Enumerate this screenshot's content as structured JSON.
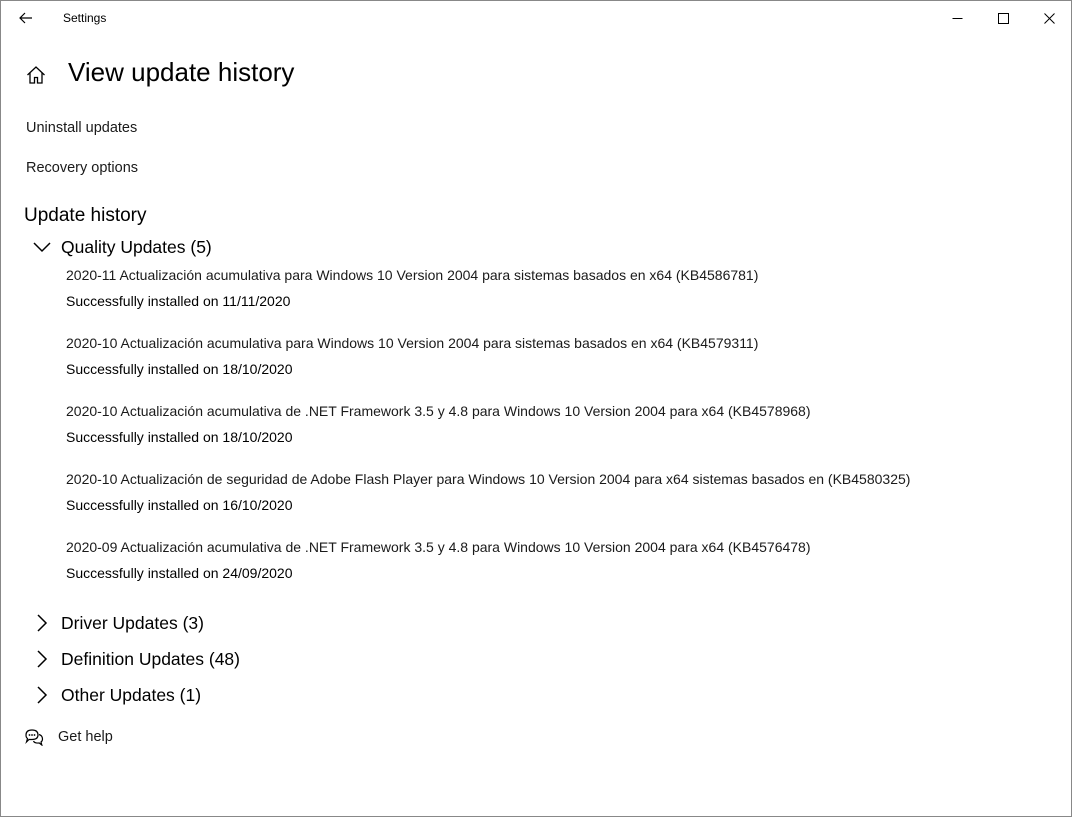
{
  "window": {
    "title": "Settings",
    "minimize_icon": "minimize-icon",
    "maximize_icon": "maximize-icon",
    "close_icon": "close-icon",
    "back_icon": "back-arrow-icon"
  },
  "page": {
    "title": "View update history",
    "home_icon": "home-icon"
  },
  "links": {
    "uninstall": "Uninstall updates",
    "recovery": "Recovery options"
  },
  "history": {
    "heading": "Update history",
    "groups": [
      {
        "label": "Quality Updates (5)",
        "expanded": true,
        "items": [
          {
            "name": "2020-11 Actualización acumulativa para Windows 10 Version 2004 para sistemas basados en x64 (KB4586781)",
            "status": "Successfully installed on 11/11/2020"
          },
          {
            "name": "2020-10 Actualización acumulativa para Windows 10 Version 2004 para sistemas basados en x64 (KB4579311)",
            "status": "Successfully installed on 18/10/2020"
          },
          {
            "name": "2020-10 Actualización acumulativa de .NET Framework 3.5 y 4.8 para Windows 10 Version 2004 para x64 (KB4578968)",
            "status": "Successfully installed on 18/10/2020"
          },
          {
            "name": "2020-10 Actualización de seguridad de Adobe Flash Player para Windows 10 Version 2004 para x64 sistemas basados en (KB4580325)",
            "status": "Successfully installed on 16/10/2020"
          },
          {
            "name": "2020-09 Actualización acumulativa de .NET Framework 3.5 y 4.8 para Windows 10 Version 2004 para x64 (KB4576478)",
            "status": "Successfully installed on 24/09/2020"
          }
        ]
      },
      {
        "label": "Driver Updates (3)",
        "expanded": false
      },
      {
        "label": "Definition Updates (48)",
        "expanded": false
      },
      {
        "label": "Other Updates (1)",
        "expanded": false
      }
    ]
  },
  "help": {
    "label": "Get help",
    "icon": "chat-help-icon"
  }
}
